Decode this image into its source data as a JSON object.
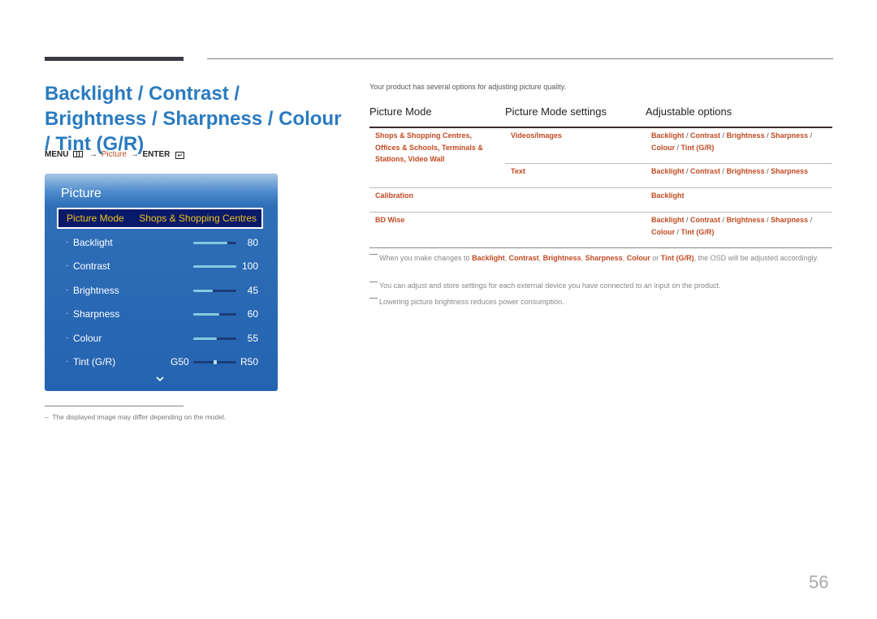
{
  "page": {
    "title": "Backlight / Contrast / Brightness / Sharpness / Colour / Tint (G/R)",
    "menu_path": {
      "menu_label": "MENU",
      "menu_icon": "menu-icon",
      "arrow": "→",
      "picture_label": "Picture",
      "enter_label": "ENTER",
      "enter_icon": "enter-icon",
      "enter_glyph": "↵"
    },
    "page_number": "56",
    "footnote": "The displayed image may differ depending on the model.",
    "footnote_dash": "–"
  },
  "osd": {
    "title": "Picture",
    "selected": {
      "label": "Picture Mode",
      "value": "Shops & Shopping Centres"
    },
    "bullet": "·",
    "rows": [
      {
        "name": "Backlight",
        "value": "80",
        "level": 80
      },
      {
        "name": "Contrast",
        "value": "100",
        "level": 100
      },
      {
        "name": "Brightness",
        "value": "45",
        "level": 45
      },
      {
        "name": "Sharpness",
        "value": "60",
        "level": 60
      },
      {
        "name": "Colour",
        "value": "55",
        "level": 55
      }
    ],
    "tint": {
      "name": "Tint (G/R)",
      "left": "G50",
      "right": "R50",
      "level": 50
    },
    "more_icon": "chevron-down-icon"
  },
  "content": {
    "intro": "Your product has several options for adjusting picture quality.",
    "table": {
      "headers": [
        "Picture Mode",
        "Picture Mode settings",
        "Adjustable options"
      ],
      "rows": [
        {
          "mode": [
            "Shops & Shopping Centres,",
            "Offices & Schools, Terminals &",
            "Stations, Video Wall"
          ],
          "setting": "Videos/Images",
          "options": [
            "Backlight / Contrast / Brightness / Sharpness /",
            "Colour / Tint (G/R)"
          ]
        },
        {
          "mode": [],
          "setting": "Text",
          "options": [
            "Backlight / Contrast / Brightness / Sharpness"
          ]
        },
        {
          "mode": [
            "Calibration"
          ],
          "setting": "",
          "options": [
            "Backlight"
          ]
        },
        {
          "mode": [
            "BD Wise"
          ],
          "setting": "",
          "options": [
            "Backlight / Contrast / Brightness / Sharpness /",
            "Colour / Tint (G/R)"
          ]
        }
      ]
    },
    "notes": [
      {
        "parts": [
          {
            "t": "When you make changes to ",
            "b": false
          },
          {
            "t": "Backlight",
            "b": true
          },
          {
            "t": ", ",
            "b": false
          },
          {
            "t": "Contrast",
            "b": true
          },
          {
            "t": ", ",
            "b": false
          },
          {
            "t": "Brightness",
            "b": true
          },
          {
            "t": ", ",
            "b": false
          },
          {
            "t": "Sharpness",
            "b": true
          },
          {
            "t": ", ",
            "b": false
          },
          {
            "t": "Colour",
            "b": true
          },
          {
            "t": " or ",
            "b": false
          },
          {
            "t": "Tint (G/R)",
            "b": true
          },
          {
            "t": ", the OSD will be adjusted accordingly.",
            "b": false
          }
        ]
      },
      {
        "parts": [
          {
            "t": "You can adjust and store settings for each external device you have connected to an input on the product.",
            "b": false
          }
        ]
      },
      {
        "parts": [
          {
            "t": "Lowering picture brightness reduces power consumption.",
            "b": false
          }
        ]
      }
    ]
  },
  "colors": {
    "title_blue": "#2a7bc0",
    "accent_orange": "#c24a22",
    "osd_blue": "#2463b0",
    "osd_highlight_text": "#f0c419"
  }
}
